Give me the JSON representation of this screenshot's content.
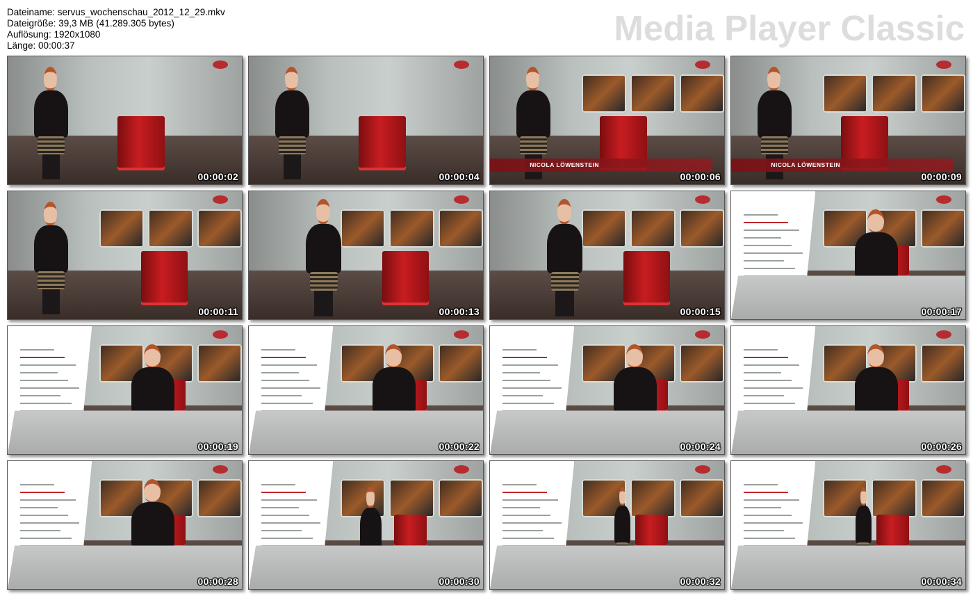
{
  "header": {
    "filename_line": "Dateiname: servus_wochenschau_2012_12_29.mkv",
    "filesize_line": "Dateigröße: 39,3 MB (41.289.305 bytes)",
    "resolution_line": "Auflösung: 1920x1080",
    "length_line": "Länge: 00:00:37"
  },
  "logo": {
    "text": "Media Player Classic",
    "color": "#dddddd"
  },
  "colors": {
    "brand_red": "#9c2024",
    "desk_red": "#c81d21"
  },
  "thumbnails": [
    {
      "timestamp": "00:00:02",
      "scene": "studio-brand"
    },
    {
      "timestamp": "00:00:04",
      "scene": "studio-brand"
    },
    {
      "timestamp": "00:00:06",
      "scene": "studio-name",
      "caption": "NICOLA LÖWENSTEIN"
    },
    {
      "timestamp": "00:00:09",
      "scene": "studio-name",
      "caption": "NICOLA LÖWENSTEIN"
    },
    {
      "timestamp": "00:00:11",
      "scene": "studio-screens"
    },
    {
      "timestamp": "00:00:13",
      "scene": "studio-screens-center"
    },
    {
      "timestamp": "00:00:15",
      "scene": "studio-screens-center"
    },
    {
      "timestamp": "00:00:17",
      "scene": "credits"
    },
    {
      "timestamp": "00:00:19",
      "scene": "credits"
    },
    {
      "timestamp": "00:00:22",
      "scene": "credits"
    },
    {
      "timestamp": "00:00:24",
      "scene": "credits"
    },
    {
      "timestamp": "00:00:26",
      "scene": "credits"
    },
    {
      "timestamp": "00:00:28",
      "scene": "credits-mid"
    },
    {
      "timestamp": "00:00:30",
      "scene": "credits-wide"
    },
    {
      "timestamp": "00:00:32",
      "scene": "credits-far"
    },
    {
      "timestamp": "00:00:34",
      "scene": "credits-far"
    }
  ]
}
